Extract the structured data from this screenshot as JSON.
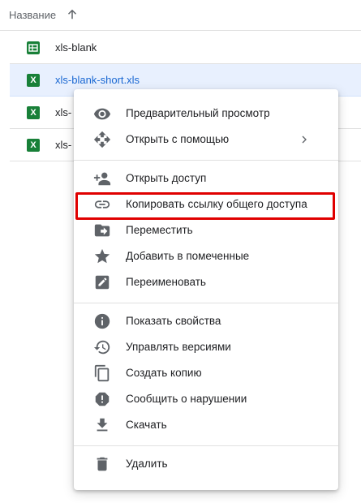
{
  "header": {
    "name_column": "Название"
  },
  "files": [
    {
      "name": "xls-blank",
      "icon": "google-sheets-icon"
    },
    {
      "name": "xls-blank-short.xls",
      "icon": "excel-file-icon"
    },
    {
      "name": "xls-",
      "icon": "excel-file-icon"
    },
    {
      "name": "xls-",
      "icon": "excel-file-icon"
    }
  ],
  "excel_glyph": "X",
  "menu": {
    "preview": "Предварительный просмотр",
    "open_with": "Открыть с помощью",
    "share": "Открыть доступ",
    "copy_link": "Копировать ссылку общего доступа",
    "move": "Переместить",
    "star": "Добавить в помеченные",
    "rename": "Переименовать",
    "details": "Показать свойства",
    "versions": "Управлять версиями",
    "make_copy": "Создать копию",
    "report": "Сообщить о нарушении",
    "download": "Скачать",
    "remove": "Удалить"
  },
  "colors": {
    "selected_row": "#e8f0fe",
    "selected_text": "#1967d2",
    "sheet_green": "#188038",
    "highlight": "#e00000",
    "icon_gray": "#5f6368"
  }
}
